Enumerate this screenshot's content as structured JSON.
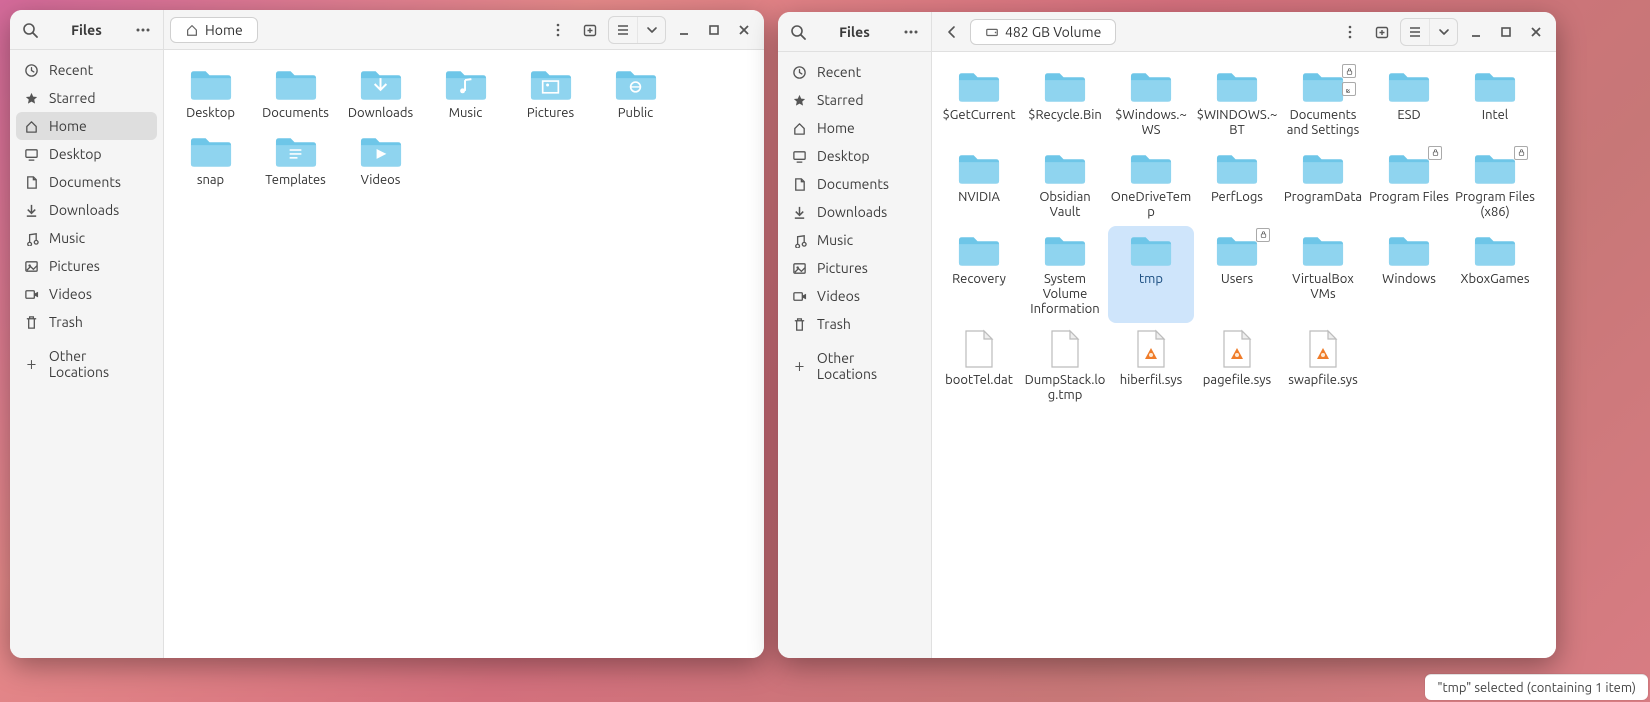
{
  "app_title": "Files",
  "window1": {
    "title": "Files",
    "path_label": "Home",
    "sidebar": [
      {
        "id": "recent",
        "icon": "clock",
        "label": "Recent",
        "active": false
      },
      {
        "id": "starred",
        "icon": "star",
        "label": "Starred",
        "active": false
      },
      {
        "id": "home",
        "icon": "home",
        "label": "Home",
        "active": true
      },
      {
        "id": "desktop",
        "icon": "desktop",
        "label": "Desktop",
        "active": false
      },
      {
        "id": "documents",
        "icon": "document",
        "label": "Documents",
        "active": false
      },
      {
        "id": "downloads",
        "icon": "download",
        "label": "Downloads",
        "active": false
      },
      {
        "id": "music",
        "icon": "music",
        "label": "Music",
        "active": false
      },
      {
        "id": "pictures",
        "icon": "picture",
        "label": "Pictures",
        "active": false
      },
      {
        "id": "videos",
        "icon": "video",
        "label": "Videos",
        "active": false
      },
      {
        "id": "trash",
        "icon": "trash",
        "label": "Trash",
        "active": false
      }
    ],
    "sidebar_other": "Other Locations",
    "items": [
      {
        "name": "Desktop",
        "type": "folder",
        "emblem": null
      },
      {
        "name": "Documents",
        "type": "folder",
        "emblem": null
      },
      {
        "name": "Downloads",
        "type": "folder",
        "emblem": "download"
      },
      {
        "name": "Music",
        "type": "folder",
        "emblem": "music"
      },
      {
        "name": "Pictures",
        "type": "folder",
        "emblem": "picture"
      },
      {
        "name": "Public",
        "type": "folder",
        "emblem": "public"
      },
      {
        "name": "snap",
        "type": "folder",
        "emblem": null
      },
      {
        "name": "Templates",
        "type": "folder",
        "emblem": "template"
      },
      {
        "name": "Videos",
        "type": "folder",
        "emblem": "video"
      }
    ]
  },
  "window2": {
    "title": "Files",
    "path_label": "482 GB Volume",
    "path_icon": "drive",
    "back_enabled": true,
    "sidebar": [
      {
        "id": "recent",
        "icon": "clock",
        "label": "Recent",
        "active": false
      },
      {
        "id": "starred",
        "icon": "star",
        "label": "Starred",
        "active": false
      },
      {
        "id": "home",
        "icon": "home",
        "label": "Home",
        "active": false
      },
      {
        "id": "desktop",
        "icon": "desktop",
        "label": "Desktop",
        "active": false
      },
      {
        "id": "documents",
        "icon": "document",
        "label": "Documents",
        "active": false
      },
      {
        "id": "downloads",
        "icon": "download",
        "label": "Downloads",
        "active": false
      },
      {
        "id": "music",
        "icon": "music",
        "label": "Music",
        "active": false
      },
      {
        "id": "pictures",
        "icon": "picture",
        "label": "Pictures",
        "active": false
      },
      {
        "id": "videos",
        "icon": "video",
        "label": "Videos",
        "active": false
      },
      {
        "id": "trash",
        "icon": "trash",
        "label": "Trash",
        "active": false
      }
    ],
    "sidebar_other": "Other Locations",
    "items": [
      {
        "name": "$GetCurrent",
        "type": "folder",
        "badge": null
      },
      {
        "name": "$Recycle.Bin",
        "type": "folder",
        "badge": null
      },
      {
        "name": "$Windows.~WS",
        "type": "folder",
        "badge": null
      },
      {
        "name": "$WINDOWS.~BT",
        "type": "folder",
        "badge": null
      },
      {
        "name": "Documents and Settings",
        "type": "folder",
        "badge": "linklock"
      },
      {
        "name": "ESD",
        "type": "folder",
        "badge": null
      },
      {
        "name": "Intel",
        "type": "folder",
        "badge": null
      },
      {
        "name": "NVIDIA",
        "type": "folder",
        "badge": null
      },
      {
        "name": "Obsidian Vault",
        "type": "folder",
        "badge": null
      },
      {
        "name": "OneDriveTemp",
        "type": "folder",
        "badge": null
      },
      {
        "name": "PerfLogs",
        "type": "folder",
        "badge": null
      },
      {
        "name": "ProgramData",
        "type": "folder",
        "badge": null
      },
      {
        "name": "Program Files",
        "type": "folder",
        "badge": "lock"
      },
      {
        "name": "Program Files (x86)",
        "type": "folder",
        "badge": "lock"
      },
      {
        "name": "Recovery",
        "type": "folder",
        "badge": null
      },
      {
        "name": "System Volume Information",
        "type": "folder",
        "badge": null
      },
      {
        "name": "tmp",
        "type": "folder",
        "badge": null,
        "selected": true
      },
      {
        "name": "Users",
        "type": "folder",
        "badge": "lock"
      },
      {
        "name": "VirtualBox VMs",
        "type": "folder",
        "badge": null
      },
      {
        "name": "Windows",
        "type": "folder",
        "badge": null
      },
      {
        "name": "XboxGames",
        "type": "folder",
        "badge": null
      },
      {
        "name": "bootTel.dat",
        "type": "file",
        "badge": null
      },
      {
        "name": "DumpStack.log.tmp",
        "type": "file",
        "badge": null
      },
      {
        "name": "hiberfil.sys",
        "type": "appfile",
        "badge": null
      },
      {
        "name": "pagefile.sys",
        "type": "appfile",
        "badge": null
      },
      {
        "name": "swapfile.sys",
        "type": "appfile",
        "badge": null
      }
    ],
    "status": "\"tmp\" selected  (containing 1 item)"
  },
  "colors": {
    "folder_fill": "#6ec6e8",
    "folder_fill_light": "#8fd4ef",
    "selection": "#cfe5fb"
  }
}
